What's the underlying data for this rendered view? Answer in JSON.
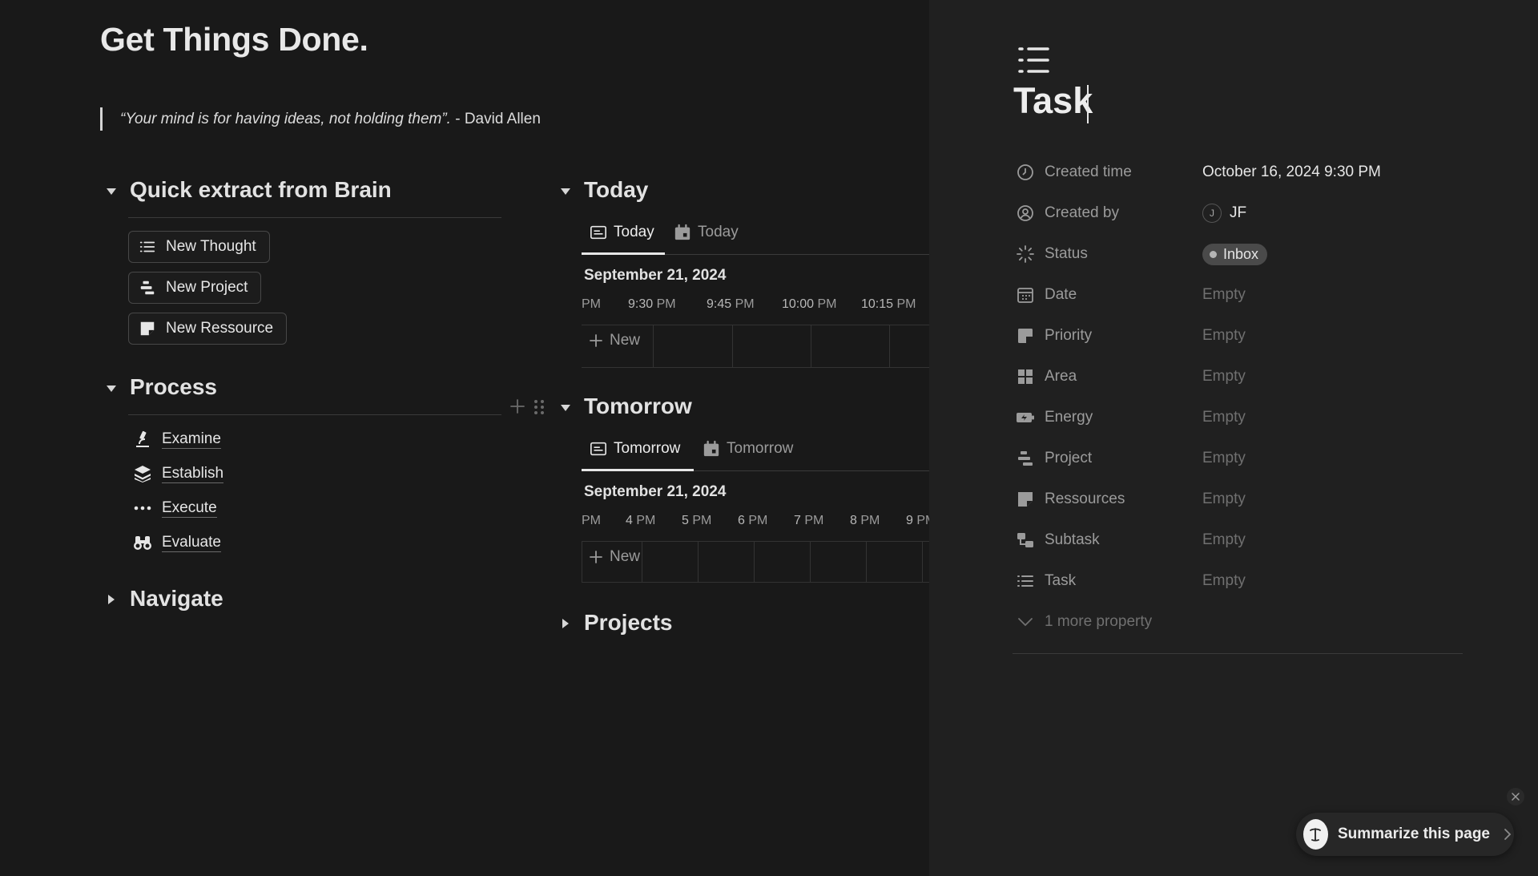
{
  "page": {
    "title": "Get Things Done.",
    "quote_italic": "“Your mind is for having ideas, not holding them”.",
    "quote_author": " - David Allen"
  },
  "quick_extract": {
    "heading": "Quick extract from  Brain",
    "buttons": [
      {
        "label": "New Thought",
        "icon": "list-icon"
      },
      {
        "label": "New Project",
        "icon": "project-icon"
      },
      {
        "label": "New Ressource",
        "icon": "note-icon"
      }
    ]
  },
  "process": {
    "heading": "Process",
    "items": [
      {
        "label": "Examine",
        "icon": "microscope-icon"
      },
      {
        "label": "Establish",
        "icon": "layers-icon"
      },
      {
        "label": "Execute",
        "icon": "ellipsis-icon"
      },
      {
        "label": "Evaluate",
        "icon": "binoculars-icon"
      }
    ]
  },
  "navigate": {
    "heading": "Navigate"
  },
  "today": {
    "heading": "Today",
    "tabs": [
      {
        "label": "Today",
        "active": true
      },
      {
        "label": "Today",
        "active": false
      }
    ],
    "date": "September 21, 2024",
    "ticks": [
      {
        "num": "",
        "unit": "PM"
      },
      {
        "num": "9:30",
        "unit": " PM"
      },
      {
        "num": "9:45",
        "unit": " PM"
      },
      {
        "num": "10:00",
        "unit": " PM"
      },
      {
        "num": "10:15",
        "unit": " PM"
      }
    ],
    "new_label": "New"
  },
  "tomorrow": {
    "heading": "Tomorrow",
    "tabs": [
      {
        "label": "Tomorrow",
        "active": true
      },
      {
        "label": "Tomorrow",
        "active": false
      }
    ],
    "date": "September 21, 2024",
    "ticks": [
      {
        "num": "",
        "unit": "PM"
      },
      {
        "num": "4",
        "unit": " PM"
      },
      {
        "num": "5",
        "unit": " PM"
      },
      {
        "num": "6",
        "unit": " PM"
      },
      {
        "num": "7",
        "unit": " PM"
      },
      {
        "num": "8",
        "unit": " PM"
      },
      {
        "num": "9",
        "unit": " PM"
      }
    ],
    "new_label": "New"
  },
  "projects": {
    "heading": "Projects"
  },
  "panel": {
    "title": "Task",
    "properties": [
      {
        "label": "Created time",
        "value": "October 16, 2024 9:30 PM",
        "icon": "clock-icon"
      },
      {
        "label": "Created by",
        "value": "JF",
        "avatar": "J",
        "icon": "user-circle-icon"
      },
      {
        "label": "Status",
        "value": "Inbox",
        "icon": "status-spinner-icon"
      },
      {
        "label": "Date",
        "value": "Empty",
        "icon": "calendar-icon"
      },
      {
        "label": "Priority",
        "value": "Empty",
        "icon": "priority-icon"
      },
      {
        "label": "Area",
        "value": "Empty",
        "icon": "grid-icon"
      },
      {
        "label": "Energy",
        "value": "Empty",
        "icon": "battery-icon"
      },
      {
        "label": "Project",
        "value": "Empty",
        "icon": "project-icon"
      },
      {
        "label": "Ressources",
        "value": "Empty",
        "icon": "note-icon"
      },
      {
        "label": "Subtask",
        "value": "Empty",
        "icon": "subtask-icon"
      },
      {
        "label": "Task",
        "value": "Empty",
        "icon": "list-icon"
      }
    ],
    "more_label": "1 more property"
  },
  "assistant": {
    "summarize_label": "Summarize this page"
  }
}
